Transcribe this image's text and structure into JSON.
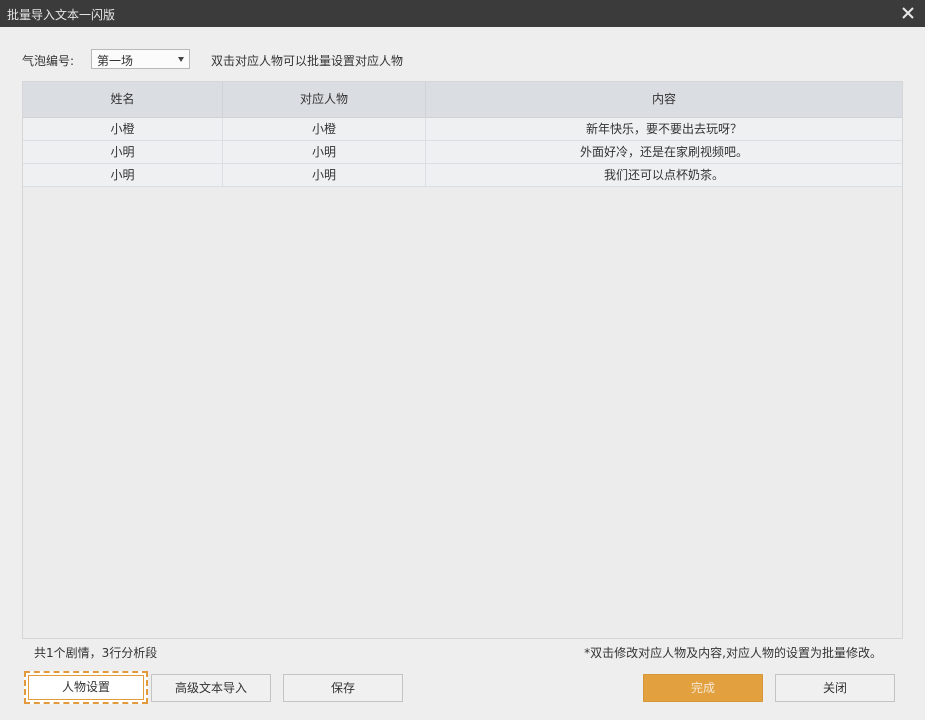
{
  "window": {
    "title": "批量导入文本一闪版"
  },
  "filter": {
    "label": "气泡编号:",
    "selected": "第一场",
    "hint": "双击对应人物可以批量设置对应人物"
  },
  "table": {
    "headers": [
      "姓名",
      "对应人物",
      "内容"
    ],
    "rows": [
      [
        "小橙",
        "小橙",
        "新年快乐，要不要出去玩呀？"
      ],
      [
        "小明",
        "小明",
        "外面好冷，还是在家刷视频吧。"
      ],
      [
        "小明",
        "小明",
        "我们还可以点杯奶茶。"
      ]
    ]
  },
  "footer": {
    "summary": "共1个剧情，3行分析段",
    "note": "*双击修改对应人物及内容,对应人物的设置为批量修改。"
  },
  "buttons": {
    "people": "人物设置",
    "import": "高级文本导入",
    "save": "保存",
    "done": "完成",
    "close": "关闭"
  },
  "colors": {
    "accent": "#e2a03f",
    "titlebar": "#3b3b3b",
    "focus": "#e39a3c"
  },
  "icons": {
    "close": "close-icon",
    "dropdown": "chevron-down-icon"
  }
}
